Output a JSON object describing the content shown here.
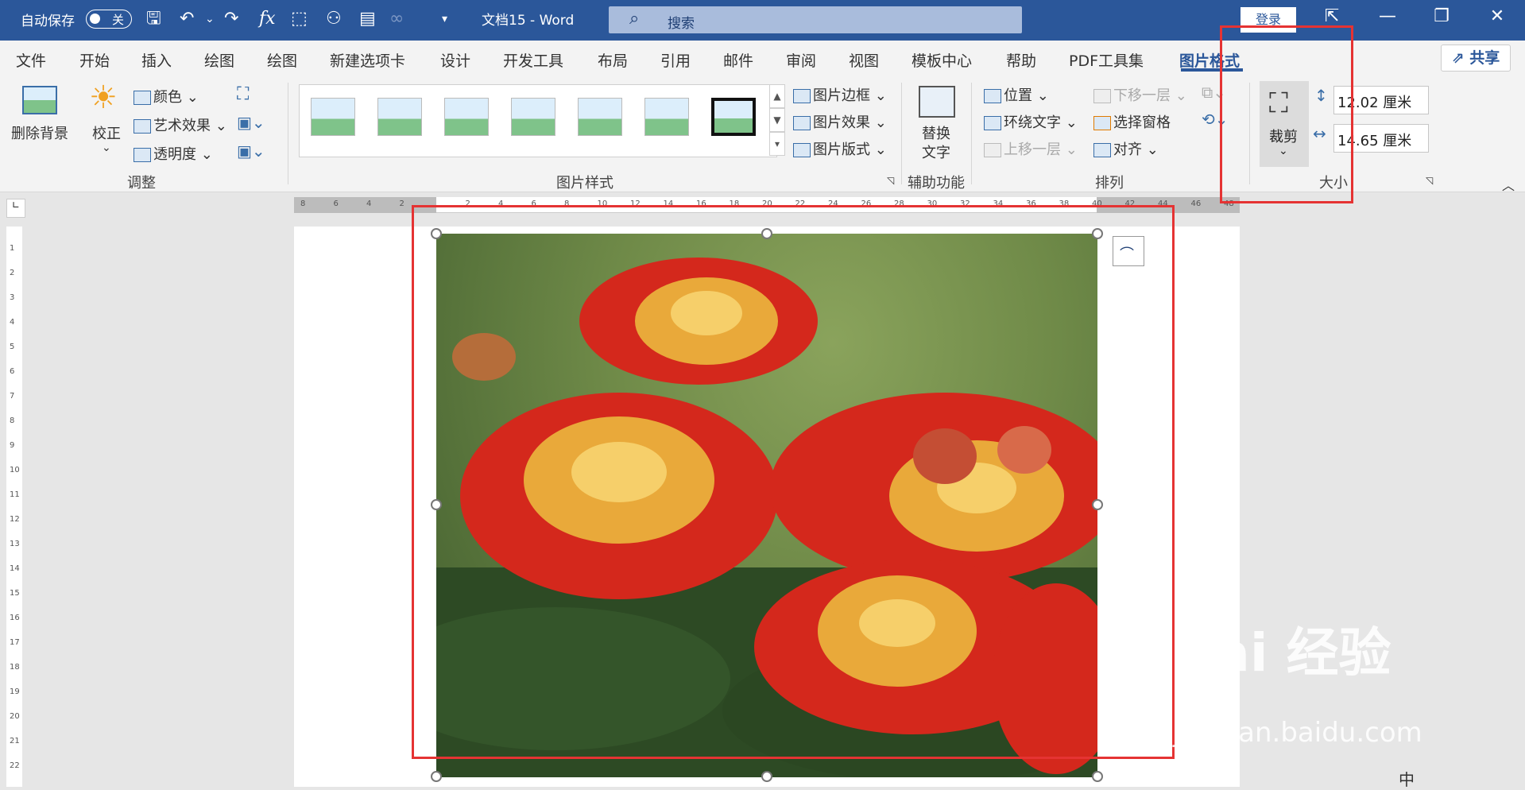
{
  "titlebar": {
    "autosave_label": "自动保存",
    "autosave_state": "关",
    "doc_title": "文档15  -  Word",
    "search_placeholder": "搜索",
    "login_label": "登录",
    "quick_access_icons": [
      "save-icon",
      "undo-icon",
      "redo-icon",
      "formula-icon",
      "select-icon",
      "org-chart-icon",
      "doc-export-icon",
      "link-icon",
      "customize-icon"
    ],
    "window_buttons": [
      "ribbon-display-icon",
      "minimize-icon",
      "restore-icon",
      "close-icon"
    ]
  },
  "tabs": [
    "文件",
    "开始",
    "插入",
    "绘图",
    "绘图",
    "新建选项卡",
    "设计",
    "开发工具",
    "布局",
    "引用",
    "邮件",
    "审阅",
    "视图",
    "模板中心",
    "帮助",
    "PDF工具集",
    "图片格式"
  ],
  "active_tab": "图片格式",
  "share_label": "共享",
  "ribbon": {
    "adjust": {
      "remove_bg": "删除背景",
      "corrections": "校正",
      "color": "颜色",
      "artistic": "艺术效果",
      "transparency": "透明度",
      "group_label": "调整"
    },
    "styles": {
      "border": "图片边框",
      "effects": "图片效果",
      "layout": "图片版式",
      "group_label": "图片样式"
    },
    "accessibility": {
      "alt_text_line1": "替换",
      "alt_text_line2": "文字",
      "group_label": "辅助功能"
    },
    "arrange": {
      "position": "位置",
      "wrap_text": "环绕文字",
      "bring_forward": "上移一层",
      "send_backward": "下移一层",
      "selection_pane": "选择窗格",
      "align": "对齐",
      "group_label": "排列"
    },
    "size": {
      "crop": "裁剪",
      "height": "12.02 厘米",
      "width": "14.65 厘米",
      "group_label": "大小"
    }
  },
  "ruler": {
    "h_ticks": [
      "8",
      "6",
      "4",
      "2",
      "",
      "2",
      "4",
      "6",
      "8",
      "10",
      "12",
      "14",
      "16",
      "18",
      "20",
      "22",
      "24",
      "26",
      "28",
      "30",
      "32",
      "34",
      "36",
      "38",
      "40",
      "42",
      "44",
      "46",
      "48"
    ],
    "v_ticks": [
      "1",
      "2",
      "3",
      "4",
      "5",
      "6",
      "7",
      "8",
      "9",
      "10",
      "11",
      "12",
      "13",
      "14",
      "15",
      "16",
      "17",
      "18",
      "19",
      "20",
      "21",
      "22"
    ]
  },
  "watermark": {
    "line1": "Bai 经验",
    "line2": "jingyan.baidu.com"
  },
  "statusbar_text": "中"
}
